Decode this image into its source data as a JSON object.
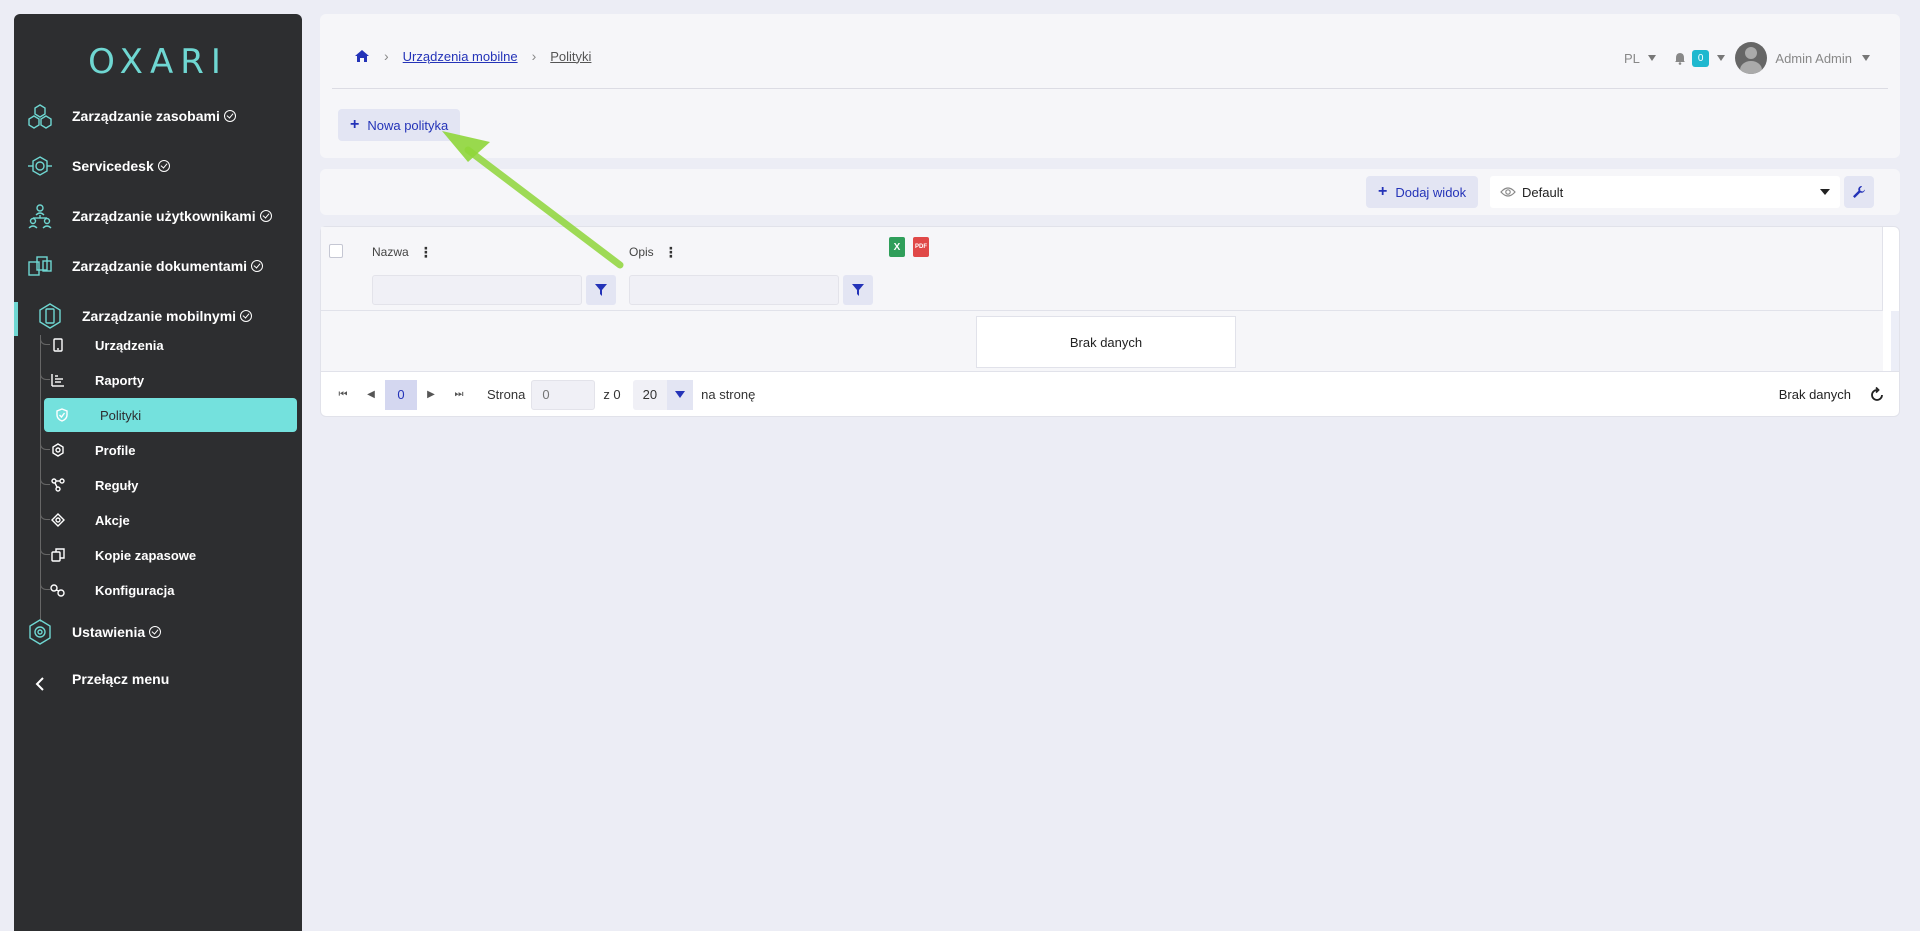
{
  "sidebar": {
    "logo": "OXARI",
    "items": [
      {
        "label": "Zarządzanie zasobami"
      },
      {
        "label": "Servicedesk"
      },
      {
        "label": "Zarządzanie użytkownikami"
      },
      {
        "label": "Zarządzanie dokumentami"
      },
      {
        "label": "Zarządzanie mobilnymi"
      }
    ],
    "sub_items": [
      {
        "label": "Urządzenia"
      },
      {
        "label": "Raporty"
      },
      {
        "label": "Polityki"
      },
      {
        "label": "Profile"
      },
      {
        "label": "Reguły"
      },
      {
        "label": "Akcje"
      },
      {
        "label": "Kopie zapasowe"
      },
      {
        "label": "Konfiguracja"
      }
    ],
    "settings_label": "Ustawienia",
    "toggle_label": "Przełącz menu"
  },
  "header": {
    "breadcrumb": [
      "Urządzenia mobilne",
      "Polityki"
    ],
    "language": "PL",
    "notifications_count": "0",
    "user_name": "Admin Admin",
    "new_policy_label": "Nowa polityka"
  },
  "toolbar": {
    "add_view_label": "Dodaj widok",
    "view_selected": "Default"
  },
  "grid": {
    "columns": [
      "Nazwa",
      "Opis"
    ],
    "empty_text": "Brak danych"
  },
  "pager": {
    "current_page": "0",
    "page_label": "Strona",
    "page_input": "0",
    "of_label": "z 0",
    "page_size": "20",
    "per_page_label": "na stronę",
    "status": "Brak danych"
  },
  "colors": {
    "accent": "#2433b8",
    "sidebar_bg": "#2d2e30",
    "active_bg": "#74e1dd",
    "teal": "#6fd7d2",
    "arrow": "#8fd63a"
  },
  "icons": {
    "excel": "excel-export-icon",
    "pdf": "pdf-export-icon"
  }
}
